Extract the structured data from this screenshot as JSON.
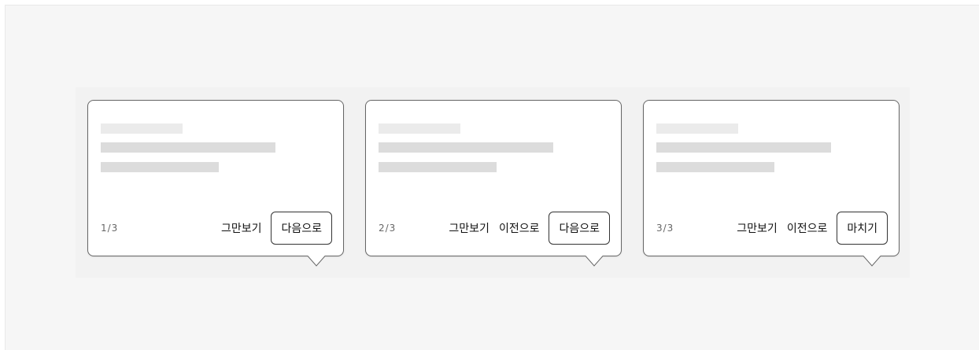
{
  "tooltips": [
    {
      "counter": "1/3",
      "skip_label": "그만보기",
      "next_label": "다음으로"
    },
    {
      "counter": "2/3",
      "skip_label": "그만보기",
      "prev_label": "이전으로",
      "next_label": "다음으로"
    },
    {
      "counter": "3/3",
      "skip_label": "그만보기",
      "prev_label": "이전으로",
      "finish_label": "마치기"
    }
  ]
}
